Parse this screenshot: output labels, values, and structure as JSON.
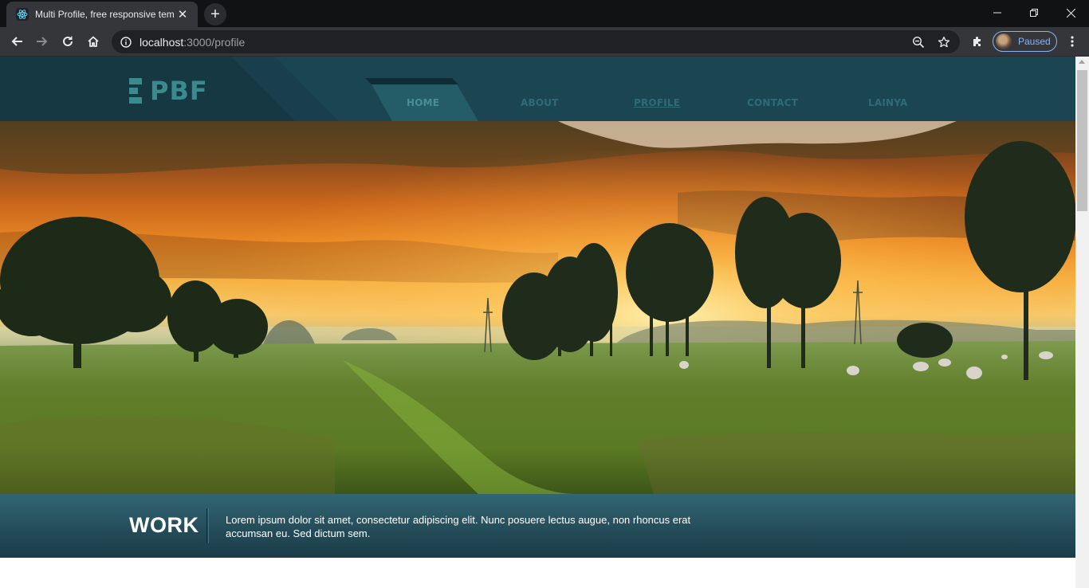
{
  "browser": {
    "tab_title": "Multi Profile, free responsive tem",
    "favicon": "react-atom-icon",
    "new_tab_symbol": "+",
    "url_host": "localhost",
    "url_rest": ":3000/profile",
    "profile_status": "Paused"
  },
  "site": {
    "logo_text": "PBF",
    "nav": [
      {
        "label": "HOME",
        "state": "active"
      },
      {
        "label": "ABOUT",
        "state": "normal"
      },
      {
        "label": "PROFILE",
        "state": "current"
      },
      {
        "label": "CONTACT",
        "state": "normal"
      },
      {
        "label": "LAINYA",
        "state": "normal"
      }
    ],
    "work": {
      "title": "WORK",
      "text": "Lorem ipsum dolor sit amet, consectetur adipiscing elit. Nunc posuere lectus augue, non rhoncus erat accumsan eu. Sed dictum sem."
    }
  },
  "colors": {
    "header_bg": "#1c4552",
    "accent_teal": "#3a8a8e",
    "chrome_dark": "#35363a",
    "profile_blue": "#8ab4f8"
  }
}
